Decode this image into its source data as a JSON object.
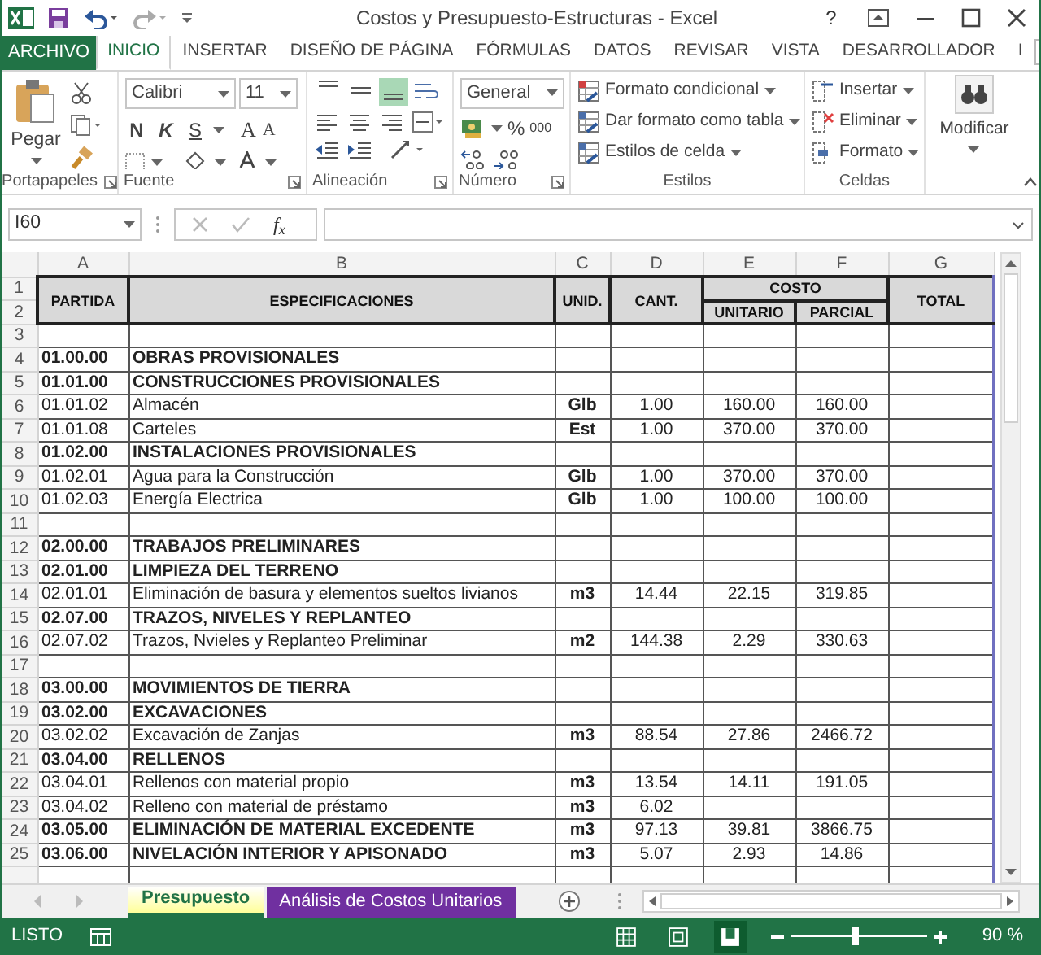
{
  "window": {
    "title": "Costos y Presupuesto-Estructuras - Excel",
    "help": "?"
  },
  "ribbon_tabs": [
    {
      "label": "ARCHIVO",
      "kind": "file",
      "selected": false
    },
    {
      "label": "INICIO",
      "kind": "tab",
      "selected": true
    },
    {
      "label": "INSERTAR",
      "kind": "tab",
      "selected": false
    },
    {
      "label": "DISEÑO DE PÁGINA",
      "kind": "tab",
      "selected": false
    },
    {
      "label": "FÓRMULAS",
      "kind": "tab",
      "selected": false
    },
    {
      "label": "DATOS",
      "kind": "tab",
      "selected": false
    },
    {
      "label": "REVISAR",
      "kind": "tab",
      "selected": false
    },
    {
      "label": "VISTA",
      "kind": "tab",
      "selected": false
    },
    {
      "label": "DESARROLLADOR",
      "kind": "tab",
      "selected": false
    },
    {
      "label": "I",
      "kind": "tab",
      "selected": false
    }
  ],
  "ribbon": {
    "clipboard": {
      "paste": "Pegar",
      "label": "Portapapeles"
    },
    "font": {
      "name": "Calibri",
      "size": "11",
      "bold": "N",
      "italic": "K",
      "underline": "S",
      "grow": "A",
      "shrink": "A",
      "label": "Fuente"
    },
    "alignment": {
      "vertical_buttons": [
        {
          "selected": false
        },
        {
          "selected": false
        },
        {
          "selected": true
        }
      ],
      "label": "Alineación"
    },
    "number": {
      "format": "General",
      "percent": "%",
      "thousands": "000",
      "label": "Número"
    },
    "styles": {
      "commands": [
        "Formato condicional",
        "Dar formato como tabla",
        "Estilos de celda"
      ],
      "label": "Estilos"
    },
    "cells": {
      "commands": [
        "Insertar",
        "Eliminar",
        "Formato"
      ],
      "label": "Celdas"
    },
    "editing": {
      "label": "Modificar"
    }
  },
  "formula_bar": {
    "name_box": "I60",
    "fx": "f$_{x}$"
  },
  "columns": [
    "A",
    "B",
    "C",
    "D",
    "E",
    "F",
    "G"
  ],
  "header": {
    "row_numbers": [
      "1",
      "2"
    ],
    "partida": "PARTIDA",
    "specs": "ESPECIFICACIONES",
    "unit": "UNID.",
    "qty": "CANT.",
    "cost": "COSTO",
    "unit_cost": "UNITARIO",
    "partial": "PARCIAL",
    "total": "TOTAL"
  },
  "rows": [
    {
      "number": "3"
    },
    {
      "number": "4",
      "bold": true,
      "partida": "01.00.00",
      "spec": "OBRAS PROVISIONALES"
    },
    {
      "number": "5",
      "bold": true,
      "partida": "01.01.00",
      "spec": "CONSTRUCCIONES PROVISIONALES"
    },
    {
      "number": "6",
      "bold": false,
      "partida": "01.01.02",
      "spec": "Almacén",
      "unit": "Glb",
      "qty": "1.00",
      "unit_cost": "160.00",
      "partial": "160.00"
    },
    {
      "number": "7",
      "bold": false,
      "partida": "01.01.08",
      "spec": "Carteles",
      "unit": "Est",
      "qty": "1.00",
      "unit_cost": "370.00",
      "partial": "370.00"
    },
    {
      "number": "8",
      "bold": true,
      "partida": "01.02.00",
      "spec": "INSTALACIONES PROVISIONALES"
    },
    {
      "number": "9",
      "bold": false,
      "partida": "01.02.01",
      "spec": "Agua para la Construcción",
      "unit": "Glb",
      "qty": "1.00",
      "unit_cost": "370.00",
      "partial": "370.00"
    },
    {
      "number": "10",
      "bold": false,
      "partida": "01.02.03",
      "spec": "Energía Electrica",
      "unit": "Glb",
      "qty": "1.00",
      "unit_cost": "100.00",
      "partial": "100.00"
    },
    {
      "number": "11"
    },
    {
      "number": "12",
      "bold": true,
      "partida": "02.00.00",
      "spec": "TRABAJOS PRELIMINARES"
    },
    {
      "number": "13",
      "bold": true,
      "partida": "02.01.00",
      "spec": "LIMPIEZA DEL TERRENO"
    },
    {
      "number": "14",
      "bold": false,
      "partida": "02.01.01",
      "spec": "Eliminación de basura y elementos sueltos livianos",
      "unit": "m3",
      "qty": "14.44",
      "unit_cost": "22.15",
      "partial": "319.85"
    },
    {
      "number": "15",
      "bold": true,
      "partida": "02.07.00",
      "spec": "TRAZOS, NIVELES Y REPLANTEO"
    },
    {
      "number": "16",
      "bold": false,
      "partida": "02.07.02",
      "spec": "Trazos, Nvieles y Replanteo Preliminar",
      "unit": "m2",
      "qty": "144.38",
      "unit_cost": "2.29",
      "partial": "330.63"
    },
    {
      "number": "17"
    },
    {
      "number": "18",
      "bold": true,
      "partida": "03.00.00",
      "spec": "MOVIMIENTOS DE TIERRA"
    },
    {
      "number": "19",
      "bold": true,
      "partida": "03.02.00",
      "spec": "EXCAVACIONES"
    },
    {
      "number": "20",
      "bold": false,
      "partida": "03.02.02",
      "spec": "Excavación de Zanjas",
      "unit": "m3",
      "qty": "88.54",
      "unit_cost": "27.86",
      "partial": "2466.72"
    },
    {
      "number": "21",
      "bold": true,
      "partida": "03.04.00",
      "spec": "RELLENOS"
    },
    {
      "number": "22",
      "bold": false,
      "partida": "03.04.01",
      "spec": "Rellenos con material propio",
      "unit": "m3",
      "qty": "13.54",
      "unit_cost": "14.11",
      "partial": "191.05"
    },
    {
      "number": "23",
      "bold": false,
      "partida": "03.04.02",
      "spec": "Relleno con material de préstamo",
      "unit": "m3",
      "qty": "6.02"
    },
    {
      "number": "24",
      "bold": true,
      "partida": "03.05.00",
      "spec": "ELIMINACIÓN DE MATERIAL EXCEDENTE",
      "unit": "m3",
      "qty": "97.13",
      "unit_cost": "39.81",
      "partial": "3866.75"
    },
    {
      "number": "25",
      "bold": true,
      "partida": "03.06.00",
      "spec": "NIVELACIÓN INTERIOR Y APISONADO",
      "unit": "m3",
      "qty": "5.07",
      "unit_cost": "2.93",
      "partial": "14.86"
    }
  ],
  "sheet_tabs": [
    {
      "label": "Presupuesto",
      "selected": true,
      "color": "#ffff99"
    },
    {
      "label": "Análisis de Costos Unitarios",
      "selected": false,
      "color": "#7030a0"
    }
  ],
  "status_bar": {
    "mode": "LISTO",
    "views": [
      {
        "selected": false
      },
      {
        "selected": false
      },
      {
        "selected": true
      }
    ],
    "zoom": {
      "level": 0.48,
      "reading": "90 %"
    }
  }
}
